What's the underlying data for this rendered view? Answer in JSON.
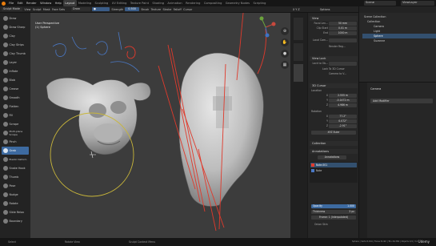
{
  "menubar": {
    "menus": [
      "File",
      "Edit",
      "Render",
      "Window",
      "Help"
    ],
    "workspaces": [
      "Layout",
      "Modeling",
      "Sculpting",
      "UV Editing",
      "Texture Paint",
      "Shading",
      "Animation",
      "Rendering",
      "Compositing",
      "Geometry Nodes",
      "Scripting"
    ],
    "active_workspace": "Layout",
    "scene_label": "Scene",
    "view_layer_label": "ViewLayer"
  },
  "header": {
    "mode": "Sculpt Mode",
    "menus": [
      "View",
      "Sculpt",
      "Mask",
      "Face Sets"
    ],
    "brush_name": "Draw",
    "strength_label": "Strength",
    "strength_value": "0.500",
    "brush_menu": "Brush",
    "texture_menu": "Texture",
    "stroke_menu": "Stroke",
    "falloff_menu": "Falloff",
    "cursor_menu": "Cursor",
    "xyz": "X Y Z",
    "options": "Options"
  },
  "tools": [
    "Draw",
    "Draw Sharp",
    "Clay",
    "Clay Strips",
    "Clay Thumb",
    "Layer",
    "Inflate",
    "Blob",
    "Crease",
    "Smooth",
    "Flatten",
    "Fill",
    "Scrape",
    "Multi-plane Scrape",
    "Pinch",
    "Grab",
    "Elastic Deform",
    "Snake Hook",
    "Thumb",
    "Pose",
    "Nudge",
    "Rotate",
    "Slide Relax",
    "Boundary"
  ],
  "active_tool": "Grab",
  "viewport": {
    "info_line1": "User Perspective",
    "info_line2": "(1) Sphere",
    "background_color": "#3c3c3c",
    "annotation_color": "#e03a2c",
    "sketch_color": "#4a78c4"
  },
  "npanel": {
    "view": {
      "title": "View",
      "focal_label": "Focal Len...",
      "focal_value": "50 mm",
      "clip_start_label": "Clip Start",
      "clip_start_value": "0.01 m",
      "clip_end_label": "End",
      "clip_end_value": "1000 m",
      "local_camera_label": "Local Cam...",
      "render_region": "Render Reg..."
    },
    "view_lock": {
      "title": "View Lock",
      "lock_to_obj_label": "Lock to Ob...",
      "lock_label": "Lock",
      "to_3d_cursor": "To 3D Cursor",
      "camera_to_view": "Camera to V..."
    },
    "cursor": {
      "title": "3D Cursor",
      "location_label": "Location",
      "x": "2.555 m",
      "y": "-0.1472 m",
      "z": "4.986 m",
      "rotation_label": "Rotation",
      "rx": "77.2°",
      "ry": "0.072°",
      "rz": "-2.91°",
      "rotation_mode": "XYZ Euler"
    },
    "collection": {
      "title": "Collection"
    },
    "annotations": {
      "title": "Annotations",
      "data_name": "Annotations",
      "layers": [
        "Note.001",
        "Note"
      ],
      "opacity_label": "Opacity",
      "opacity_value": "1.000",
      "thickness_label": "Thickness",
      "thickness_value": "3 px",
      "frame_mode": "Frame: 1 (Interpolated)",
      "onion_skin": "Onion Skin"
    }
  },
  "outliner": {
    "items": [
      {
        "name": "Scene Collection",
        "indent": 0
      },
      {
        "name": "Collection",
        "indent": 1
      },
      {
        "name": "Camera",
        "indent": 2
      },
      {
        "name": "Light",
        "indent": 2
      },
      {
        "name": "Sphere",
        "indent": 2
      },
      {
        "name": "Suzanne",
        "indent": 2
      }
    ],
    "selected": "Sphere"
  },
  "properties": {
    "object_name": "Camera",
    "add_modifier": "Add Modifier"
  },
  "statusbar": {
    "select": "Select",
    "rotate_view": "Rotate View",
    "context_menu": "Sculpt Context Menu",
    "stats": "Sphere | Verts 8,194 | Faces 8,192 | Tris 16,384 | Objects 1/4 | 3.4",
    "watermark": "Udemy"
  }
}
